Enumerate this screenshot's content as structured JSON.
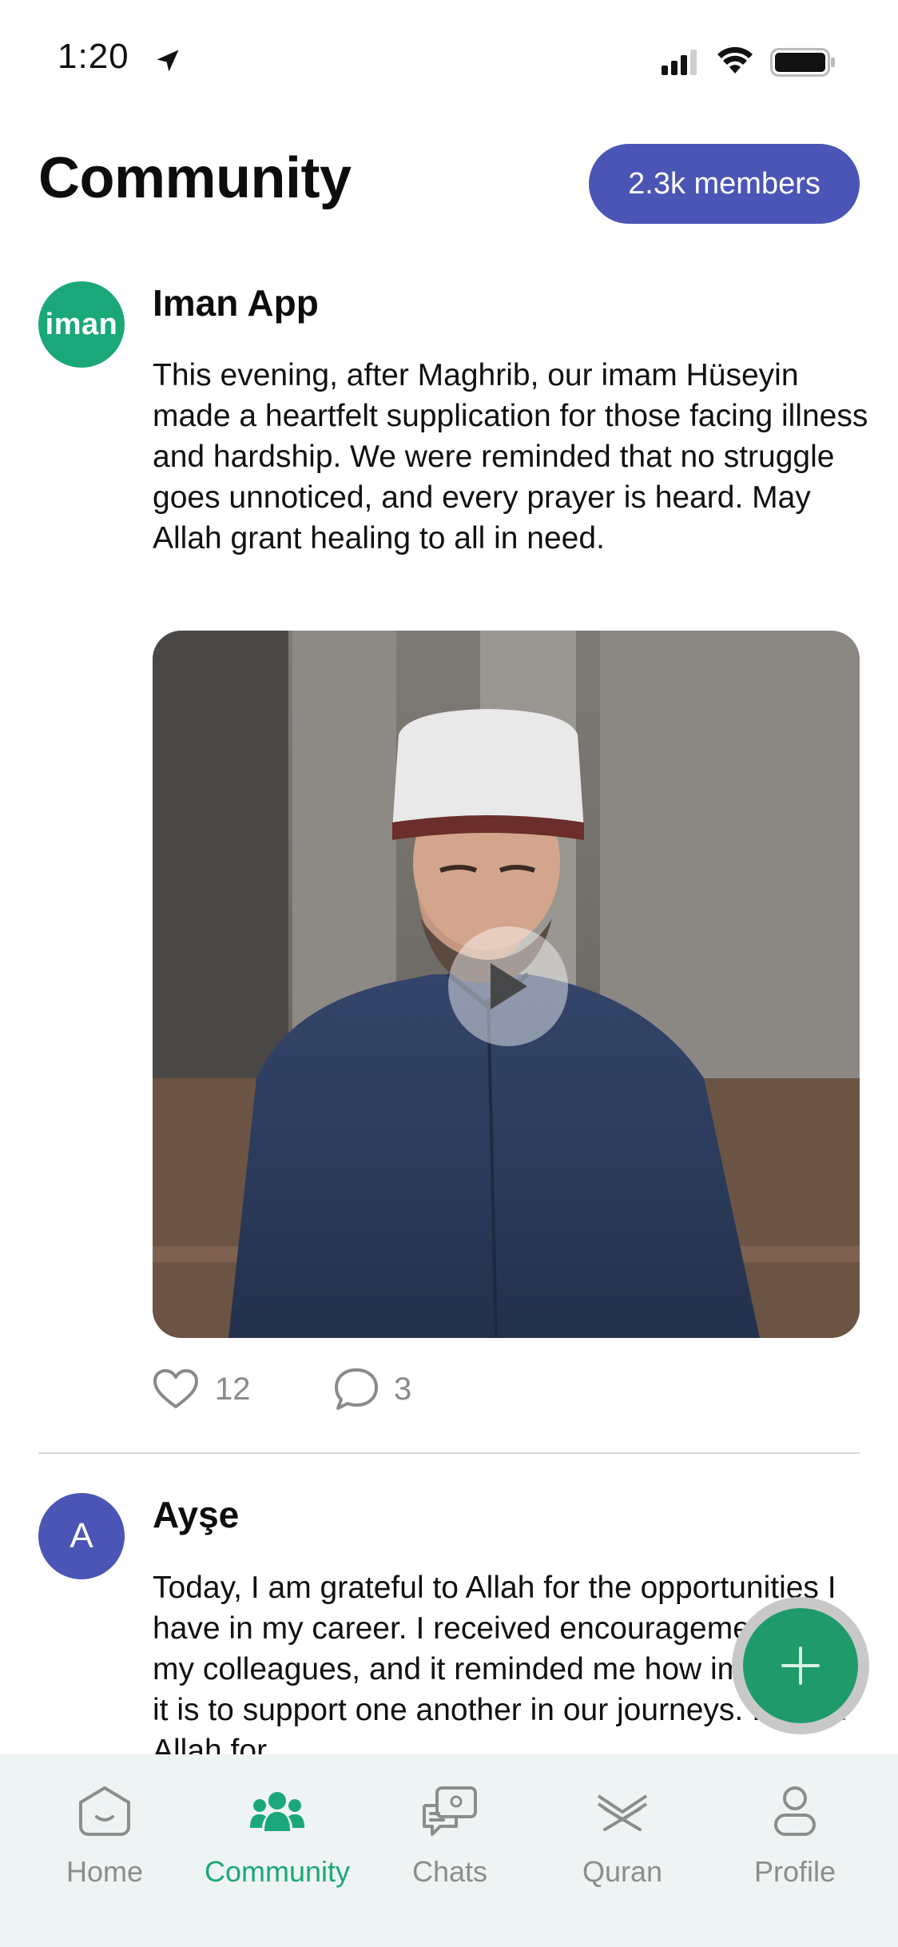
{
  "status_bar": {
    "time": "1:20"
  },
  "header": {
    "title": "Community",
    "members_badge": "2.3k members"
  },
  "posts": [
    {
      "avatar_text": "iman",
      "author": "Iman App",
      "text": "This evening, after Maghrib, our imam Hüseyin made a heartfelt supplication for those facing illness and hardship. We were reminded that no struggle goes unnoticed, and every prayer is heard. May Allah grant healing to all in need.",
      "media_type": "video",
      "likes": "12",
      "comments": "3"
    },
    {
      "avatar_text": "A",
      "author": "Ayşe",
      "text": "Today, I am grateful to Allah for the opportunities I have in my career. I received encouragement from my colleagues, and it reminded me how important it is to support one another in our journeys. I thank Allah for"
    }
  ],
  "fab": {
    "icon": "plus-icon"
  },
  "nav": {
    "items": [
      {
        "label": "Home",
        "icon": "home-icon",
        "active": false
      },
      {
        "label": "Community",
        "icon": "community-icon",
        "active": true
      },
      {
        "label": "Chats",
        "icon": "chats-icon",
        "active": false
      },
      {
        "label": "Quran",
        "icon": "quran-icon",
        "active": false
      },
      {
        "label": "Profile",
        "icon": "profile-icon",
        "active": false
      }
    ]
  },
  "colors": {
    "accent_green": "#1aa87a",
    "accent_blue": "#4a55b5",
    "nav_background": "#eef3f3"
  }
}
